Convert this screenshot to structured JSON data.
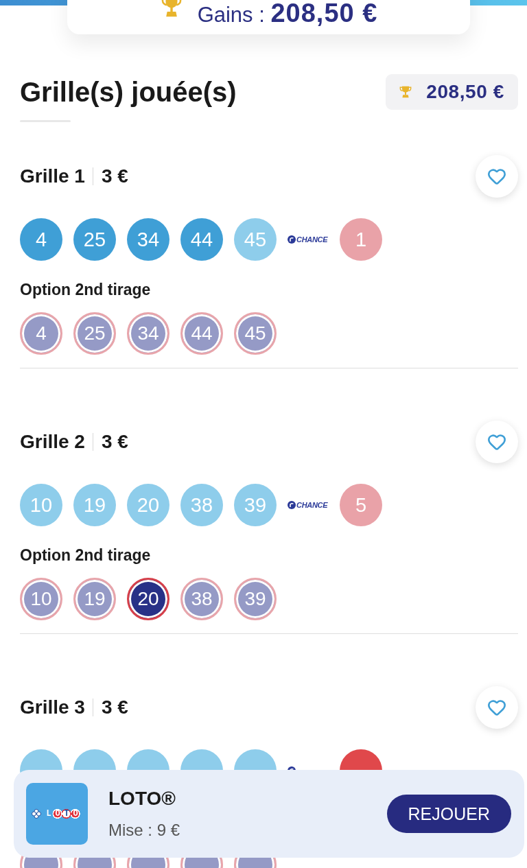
{
  "summary_card": {
    "winnings": "Gains : **208,50 €**"
  },
  "section": {
    "title": "Grille(s) jouée(s)",
    "total": "208,50 €"
  },
  "grids": [
    {
      "title": "Grille 1",
      "stake": "3 €",
      "favorite": false,
      "numbers": [
        {
          "value": "4",
          "matched": true
        },
        {
          "value": "25",
          "matched": true
        },
        {
          "value": "34",
          "matched": true
        },
        {
          "value": "44",
          "matched": true
        },
        {
          "value": "45",
          "matched": false
        }
      ],
      "chance_label": "CHANCE",
      "chance": {
        "value": "1",
        "matched": false
      },
      "option_label": "Option 2nd tirage",
      "second_draw": [
        {
          "value": "4",
          "matched": false
        },
        {
          "value": "25",
          "matched": false
        },
        {
          "value": "34",
          "matched": false
        },
        {
          "value": "44",
          "matched": false
        },
        {
          "value": "45",
          "matched": false
        }
      ]
    },
    {
      "title": "Grille 2",
      "stake": "3 €",
      "favorite": false,
      "numbers": [
        {
          "value": "10",
          "matched": false
        },
        {
          "value": "19",
          "matched": false
        },
        {
          "value": "20",
          "matched": false
        },
        {
          "value": "38",
          "matched": false
        },
        {
          "value": "39",
          "matched": false
        }
      ],
      "chance_label": "CHANCE",
      "chance": {
        "value": "5",
        "matched": false
      },
      "option_label": "Option 2nd tirage",
      "second_draw": [
        {
          "value": "10",
          "matched": false
        },
        {
          "value": "19",
          "matched": false
        },
        {
          "value": "20",
          "matched": true
        },
        {
          "value": "38",
          "matched": false
        },
        {
          "value": "39",
          "matched": false
        }
      ]
    },
    {
      "title": "Grille 3",
      "stake": "3 €",
      "favorite": false,
      "numbers": [
        {
          "matched": false
        },
        {
          "matched": false
        },
        {
          "matched": false
        },
        {
          "matched": false
        },
        {
          "matched": false
        }
      ],
      "chance": {
        "matched": true
      },
      "second_draw": [
        {
          "matched": false
        },
        {
          "matched": false
        },
        {
          "matched": false
        },
        {
          "matched": false
        },
        {
          "matched": false
        }
      ]
    }
  ],
  "footer_card": {
    "logo_text": "LOTO",
    "game": "LOTO®",
    "stake": "Mise : 9 €",
    "button": "REJOUER"
  }
}
